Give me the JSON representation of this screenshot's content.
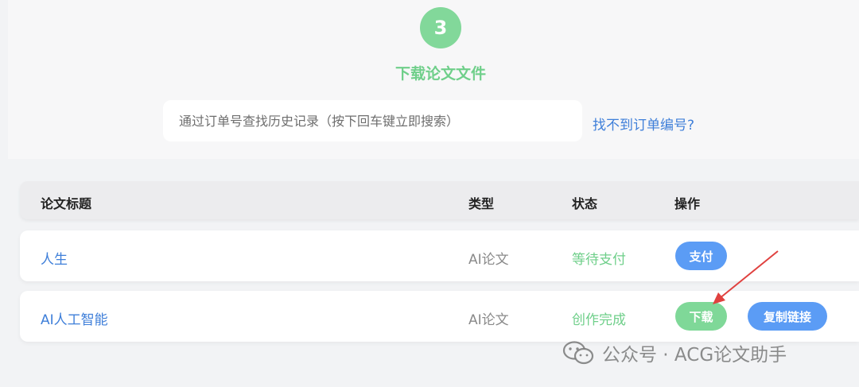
{
  "step": {
    "number": "3",
    "title": "下载论文文件"
  },
  "search": {
    "placeholder": "通过订单号查找历史记录（按下回车键立即搜索）",
    "help_link": "找不到订单编号?"
  },
  "table": {
    "headers": {
      "title": "论文标题",
      "type": "类型",
      "status": "状态",
      "actions": "操作"
    },
    "rows": [
      {
        "title": "人生",
        "type": "AI论文",
        "status": "等待支付",
        "actions": [
          "支付"
        ]
      },
      {
        "title": "AI人工智能",
        "type": "AI论文",
        "status": "创作完成",
        "actions": [
          "下载",
          "复制链接"
        ]
      }
    ]
  },
  "watermark": {
    "text": "公众号 · ACG论文助手",
    "icon": "wechat-icon"
  },
  "colors": {
    "accent_green": "#6fcf8a",
    "accent_blue": "#3f7fd9",
    "button_blue": "#5b9cf5",
    "button_green": "#7fd898",
    "annotation_red": "#e0413f"
  }
}
